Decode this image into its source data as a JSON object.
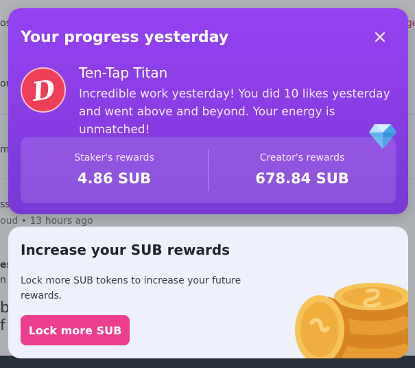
{
  "background": {
    "frags": [
      "os",
      "ge",
      "on",
      "me",
      "ss",
      "es",
      "n",
      "b",
      "f"
    ],
    "meta_text": "oud • 13 hours ago"
  },
  "progress_card": {
    "title": "Your progress yesterday",
    "close_icon": "close-icon",
    "badge_icon": "d-logo-icon",
    "badge_letter": "D",
    "badge_name": "Ten-Tap Titan",
    "badge_description": "Incredible work yesterday! You did 10 likes yesterday and went above and beyond. Your energy is unmatched!",
    "decoration_icon": "diamond-icon",
    "rewards": [
      {
        "label": "Staker's rewards",
        "value": "4.86 SUB"
      },
      {
        "label": "Creator's rewards",
        "value": "678.84 SUB"
      }
    ]
  },
  "sub_card": {
    "title": "Increase your SUB rewards",
    "description": "Lock more SUB tokens to increase your future rewards.",
    "button_label": "Lock more SUB",
    "illustration_icon": "coin-stack-icon"
  },
  "colors": {
    "card_purple": "#8a3ee6",
    "button_pink": "#ec3e8f",
    "avatar_red": "#ef3e57",
    "sub_card_bg": "#eef0fb"
  }
}
